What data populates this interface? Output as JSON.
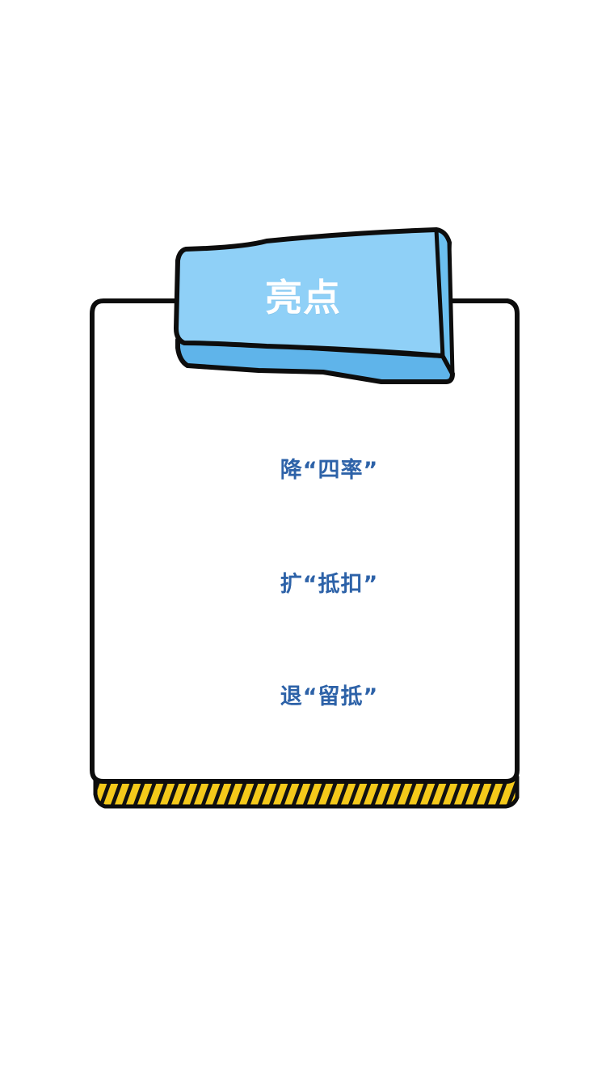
{
  "tab": {
    "title": "亮点"
  },
  "highlights": [
    {
      "text": "降“四率”"
    },
    {
      "text": "扩“抵扣”"
    },
    {
      "text": "退“留抵”"
    }
  ],
  "colors": {
    "tab_fill": "#8fd0f7",
    "tab_shade": "#5fb4ea",
    "outline": "#0d0d0d",
    "highlight_text": "#2d62a8",
    "stripe": "#f4c91a"
  }
}
